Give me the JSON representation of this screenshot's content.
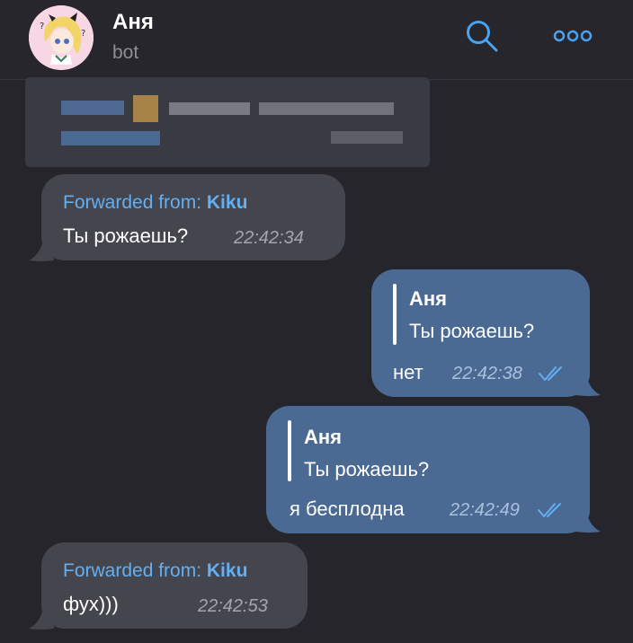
{
  "header": {
    "title": "Аня",
    "subtitle": "bot",
    "search_icon": "search-icon",
    "more_icon": "more-horizontal-icon",
    "accent": "#4aa3f0"
  },
  "messages": [
    {
      "type": "incoming",
      "forwarded_prefix": "Forwarded from: ",
      "forwarded_name": "Kiku",
      "text": "Ты рожаешь?",
      "time": "22:42:34"
    },
    {
      "type": "outgoing",
      "reply_name": "Аня",
      "reply_text": "Ты рожаешь?",
      "text": "нет",
      "time": "22:42:38",
      "status_icon": "double-check-icon"
    },
    {
      "type": "outgoing",
      "reply_name": "Аня",
      "reply_text": "Ты рожаешь?",
      "text": "я бесплодна",
      "time": "22:42:49",
      "status_icon": "double-check-icon"
    },
    {
      "type": "incoming",
      "forwarded_prefix": "Forwarded from: ",
      "forwarded_name": "Kiku",
      "text": "фух)))",
      "time": "22:42:53"
    }
  ],
  "colors": {
    "background": "#25252b",
    "incoming_bubble": "#45454d",
    "outgoing_bubble": "#4b6a93",
    "link": "#63aff2"
  }
}
